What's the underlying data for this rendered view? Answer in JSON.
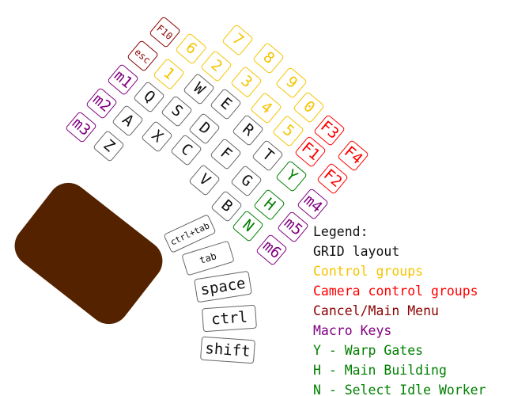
{
  "colors": {
    "grid": "#111111",
    "control": "#f5c400",
    "camera": "#ff0000",
    "menu": "#8b0000",
    "macro": "#800080",
    "special": "#008000",
    "palm": "#552200"
  },
  "keys": [
    {
      "label": "F10",
      "group": "menu"
    },
    {
      "label": "esc",
      "group": "menu"
    },
    {
      "label": "m1",
      "group": "macro"
    },
    {
      "label": "m2",
      "group": "macro"
    },
    {
      "label": "m3",
      "group": "macro"
    },
    {
      "label": "6",
      "group": "control"
    },
    {
      "label": "1",
      "group": "control"
    },
    {
      "label": "7",
      "group": "control"
    },
    {
      "label": "8",
      "group": "control"
    },
    {
      "label": "2",
      "group": "control"
    },
    {
      "label": "3",
      "group": "control"
    },
    {
      "label": "9",
      "group": "control"
    },
    {
      "label": "4",
      "group": "control"
    },
    {
      "label": "0",
      "group": "control"
    },
    {
      "label": "5",
      "group": "control"
    },
    {
      "label": "Q",
      "group": "grid"
    },
    {
      "label": "W",
      "group": "grid"
    },
    {
      "label": "E",
      "group": "grid"
    },
    {
      "label": "A",
      "group": "grid"
    },
    {
      "label": "S",
      "group": "grid"
    },
    {
      "label": "D",
      "group": "grid"
    },
    {
      "label": "R",
      "group": "grid"
    },
    {
      "label": "Z",
      "group": "grid"
    },
    {
      "label": "X",
      "group": "grid"
    },
    {
      "label": "C",
      "group": "grid"
    },
    {
      "label": "F",
      "group": "grid"
    },
    {
      "label": "T",
      "group": "grid"
    },
    {
      "label": "V",
      "group": "grid"
    },
    {
      "label": "G",
      "group": "grid"
    },
    {
      "label": "B",
      "group": "grid"
    },
    {
      "label": "Y",
      "group": "special"
    },
    {
      "label": "H",
      "group": "special"
    },
    {
      "label": "N",
      "group": "special"
    },
    {
      "label": "F3",
      "group": "camera"
    },
    {
      "label": "F4",
      "group": "camera"
    },
    {
      "label": "F1",
      "group": "camera"
    },
    {
      "label": "F2",
      "group": "camera"
    },
    {
      "label": "m4",
      "group": "macro"
    },
    {
      "label": "m5",
      "group": "macro"
    },
    {
      "label": "m6",
      "group": "macro"
    },
    {
      "label": "ctrl+tab",
      "group": "grid"
    },
    {
      "label": "tab",
      "group": "grid"
    },
    {
      "label": "space",
      "group": "grid"
    },
    {
      "label": "ctrl",
      "group": "grid"
    },
    {
      "label": "shift",
      "group": "grid"
    }
  ],
  "legend": {
    "title": "Legend:",
    "items": [
      {
        "text": "GRID layout",
        "group": "grid"
      },
      {
        "text": "Control groups",
        "group": "control"
      },
      {
        "text": "Camera control groups",
        "group": "camera"
      },
      {
        "text": "Cancel/Main Menu",
        "group": "menu"
      },
      {
        "text": "Macro Keys",
        "group": "macro"
      },
      {
        "text": "Y - Warp Gates",
        "group": "special"
      },
      {
        "text": "H - Main Building",
        "group": "special"
      },
      {
        "text": "N - Select Idle Worker",
        "group": "special"
      }
    ]
  }
}
